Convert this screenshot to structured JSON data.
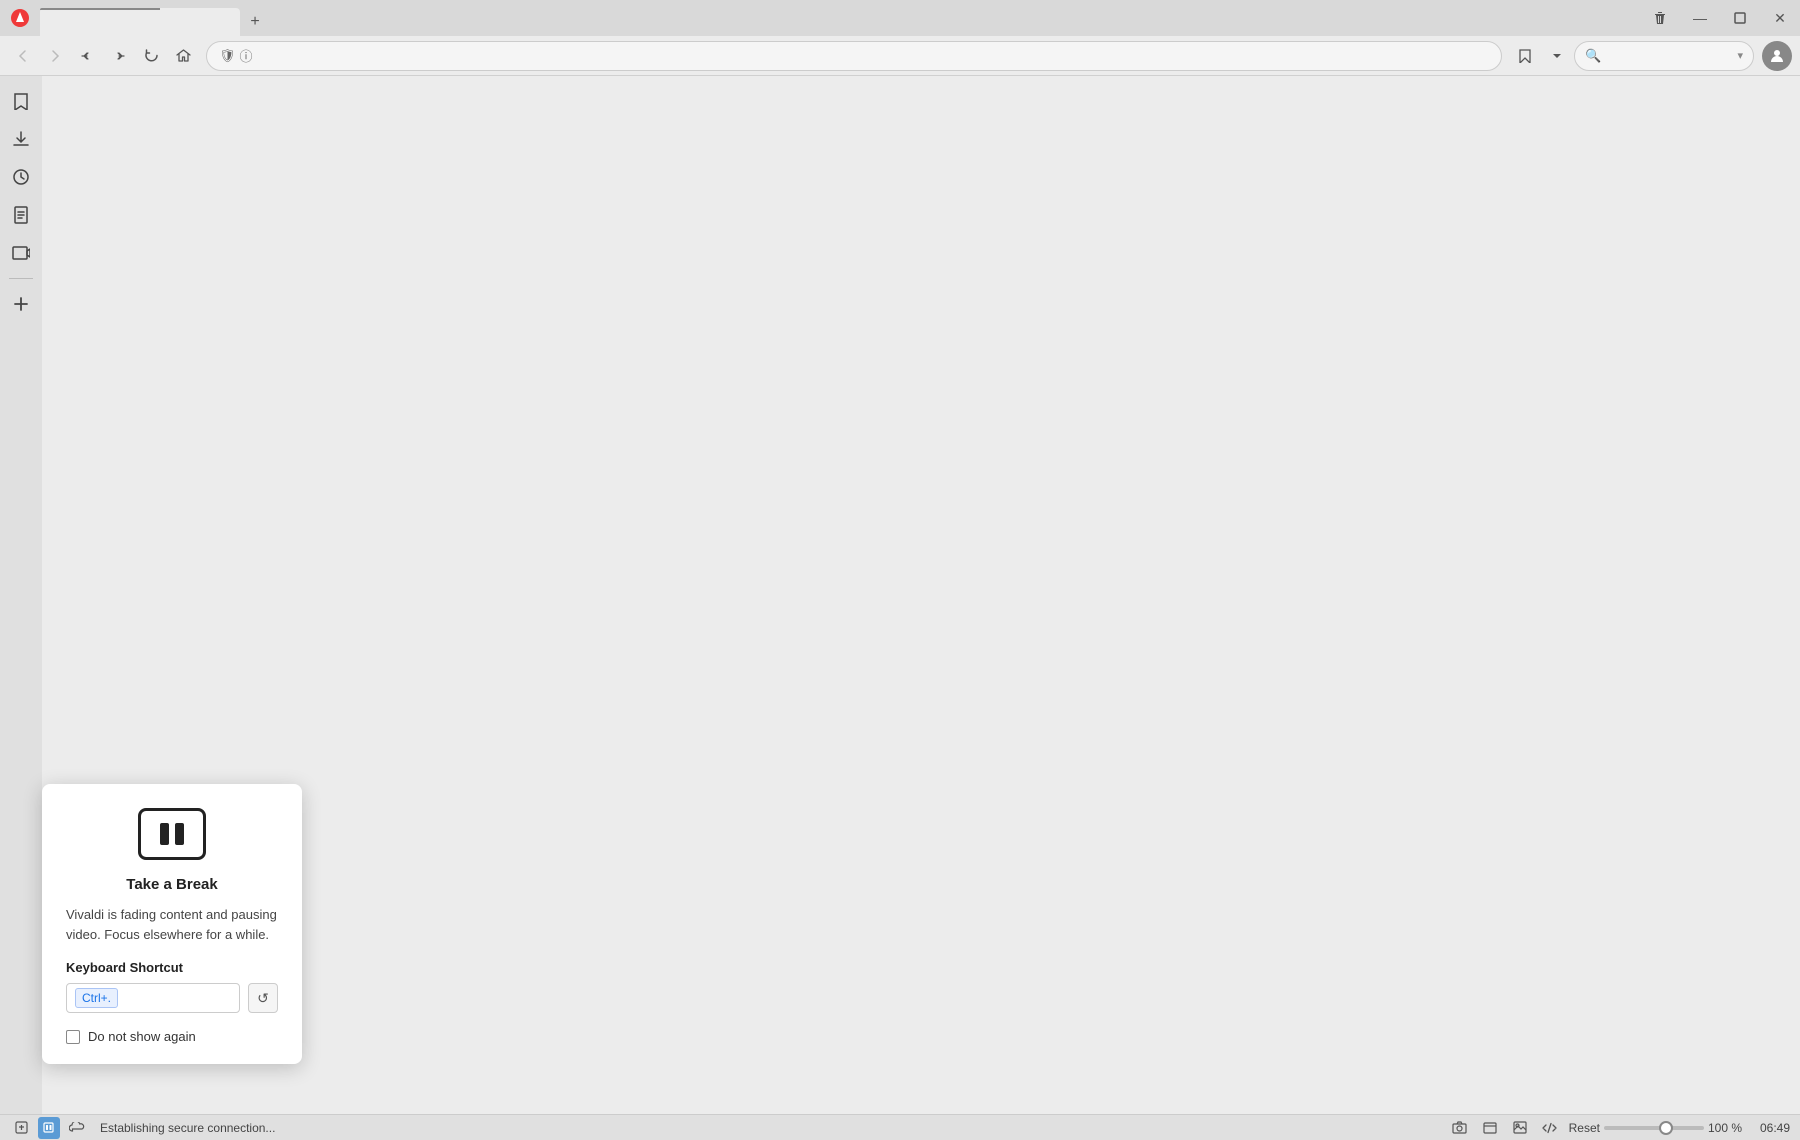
{
  "titlebar": {
    "new_tab_icon": "+",
    "controls": {
      "delete": "🗑",
      "minimize": "─",
      "restore": "❐",
      "close": "✕"
    }
  },
  "navbar": {
    "back_label": "←",
    "forward_label": "→",
    "rewind_label": "⏮",
    "fast_forward_label": "⏭",
    "reload_label": "↻",
    "home_label": "⌂",
    "shield_label": "🛡",
    "info_label": "ⓘ",
    "bookmark_label": "🔖",
    "search_placeholder": "🔍"
  },
  "sidebar": {
    "items": [
      {
        "name": "bookmark",
        "icon": "🔖"
      },
      {
        "name": "download",
        "icon": "⬇"
      },
      {
        "name": "history",
        "icon": "🕐"
      },
      {
        "name": "notes",
        "icon": "📄"
      },
      {
        "name": "captures",
        "icon": "🎬"
      },
      {
        "name": "add",
        "icon": "+"
      }
    ]
  },
  "popup": {
    "title": "Take a Break",
    "description": "Vivaldi is fading content and pausing video. Focus elsewhere for a while.",
    "shortcut_label": "Keyboard Shortcut",
    "shortcut_value": "Ctrl+.",
    "reset_icon": "↺",
    "checkbox_label": "Do not show again"
  },
  "statusbar": {
    "status_text": "Establishing secure connection...",
    "zoom_reset": "Reset",
    "zoom_percent": "100 %",
    "time": "06:49"
  }
}
